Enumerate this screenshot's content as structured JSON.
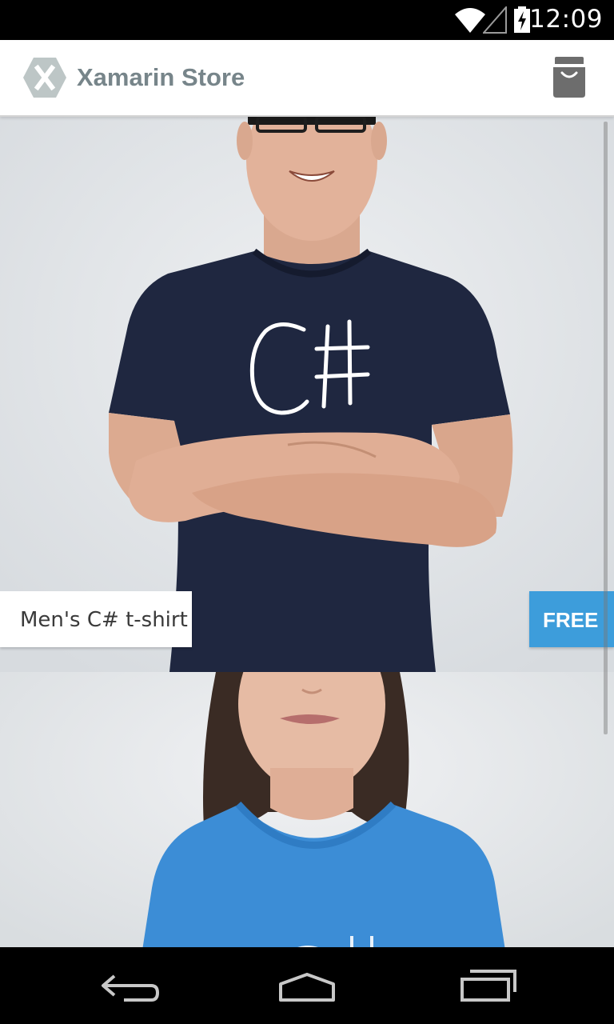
{
  "status_bar": {
    "time": "12:09",
    "icons": [
      "wifi-icon",
      "cell-signal-icon",
      "battery-charging-icon"
    ]
  },
  "action_bar": {
    "title": "Xamarin Store",
    "logo": "xamarin-logo-icon",
    "cart_icon": "shopping-bag-icon"
  },
  "products": [
    {
      "name": "Men's C# t-shirt",
      "price": "FREE",
      "shirt_print": "C#",
      "shirt_color": "#1f2740"
    },
    {
      "shirt_color": "#3c8dd6"
    }
  ],
  "nav_bar": {
    "icons": [
      "back-icon",
      "home-icon",
      "recent-apps-icon"
    ]
  },
  "colors": {
    "accent": "#3d9ddb",
    "title_gray": "#77858a"
  }
}
